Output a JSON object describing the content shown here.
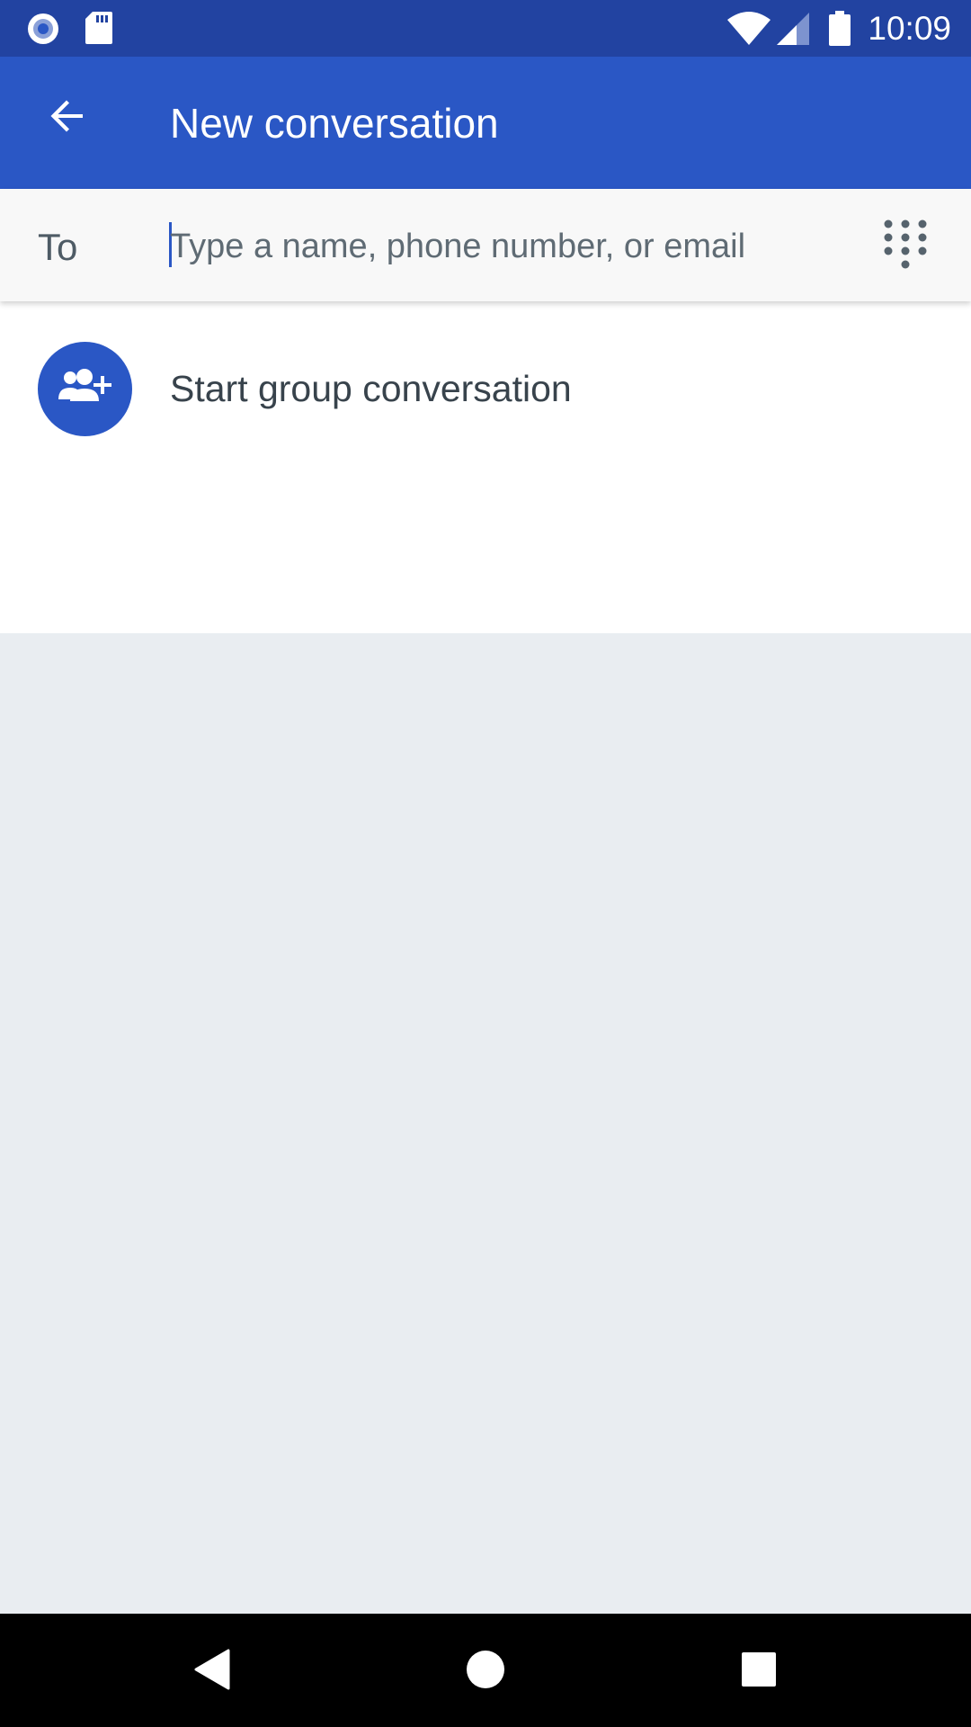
{
  "status_bar": {
    "time": "10:09",
    "icons": [
      "record-icon",
      "sd-card-icon",
      "wifi-icon",
      "cell-signal-icon",
      "battery-icon"
    ]
  },
  "app_bar": {
    "title": "New conversation",
    "back_icon": "arrow-back-icon"
  },
  "recipient": {
    "to_label": "To",
    "placeholder": "Type a name, phone number, or email",
    "value": "",
    "dialpad_icon": "dialpad-icon"
  },
  "actions": {
    "group_label": "Start group conversation",
    "group_icon": "group-add-icon"
  },
  "nav_bar": {
    "icons": [
      "back-triangle-icon",
      "home-circle-icon",
      "recents-square-icon"
    ]
  },
  "colors": {
    "status_bar": "#2243a1",
    "app_bar": "#2a57c5",
    "accent": "#2a57c5",
    "content_bg": "#ffffff",
    "empty_bg": "#e9edf1",
    "nav_bar": "#000000"
  }
}
